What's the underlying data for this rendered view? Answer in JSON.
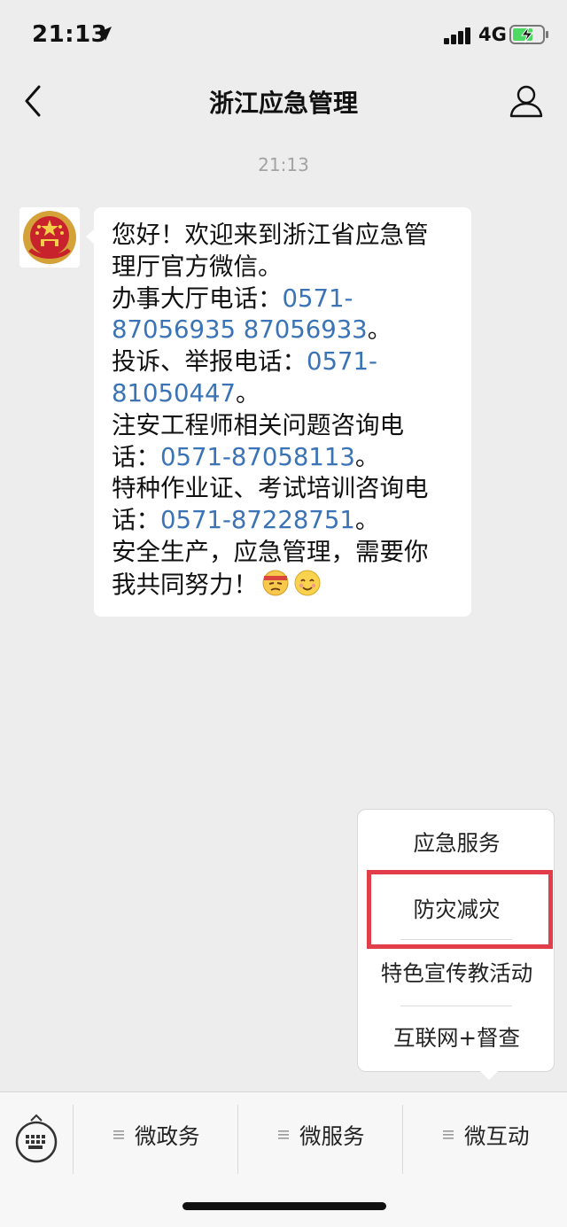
{
  "status_bar": {
    "time": "21:13",
    "network": "4G",
    "icons": [
      "location-arrow-icon",
      "signal-bars-icon",
      "battery-charging-icon"
    ]
  },
  "nav": {
    "title": "浙江应急管理",
    "icons": [
      "back-chevron-icon",
      "profile-icon"
    ]
  },
  "chat": {
    "timestamp": "21:13",
    "avatar_icon": "national-emblem-icon",
    "message_lines": [
      {
        "text": "您好！欢迎来到浙江省应急管",
        "link": ""
      },
      {
        "text": "理厅官方微信。",
        "link": ""
      },
      {
        "text": "办事大厅电话：",
        "link": "0571-"
      },
      {
        "text": "",
        "link": "87056935 87056933",
        "suffix": "。"
      },
      {
        "text": "投诉、举报电话：",
        "link": "0571-"
      },
      {
        "text": "",
        "link": "81050447",
        "suffix": "。"
      },
      {
        "text": "注安工程师相关问题咨询电",
        "link": ""
      },
      {
        "text": "话：",
        "link": "0571-87058113",
        "suffix": "。"
      },
      {
        "text": "特种作业证、考试培训咨询电",
        "link": ""
      },
      {
        "text": "话：",
        "link": "0571-87228751",
        "suffix": "。"
      },
      {
        "text": "安全生产，应急管理，需要你",
        "link": ""
      },
      {
        "text": "我共同努力！",
        "link": ""
      }
    ],
    "emojis": [
      "ninja-face-emoji-icon",
      "smiling-face-emoji-icon"
    ],
    "link_color": "#3a73b6"
  },
  "popup_menu": {
    "items": [
      "应急服务",
      "防灾减灾",
      "特色宣传教活动",
      "互联网+督查"
    ],
    "highlighted_item": "防灾减灾",
    "highlight_color": "#e23e4a"
  },
  "bottom_menu": {
    "keyboard_icon": "keyboard-toggle-icon",
    "items": [
      "微政务",
      "微服务",
      "微互动"
    ]
  }
}
